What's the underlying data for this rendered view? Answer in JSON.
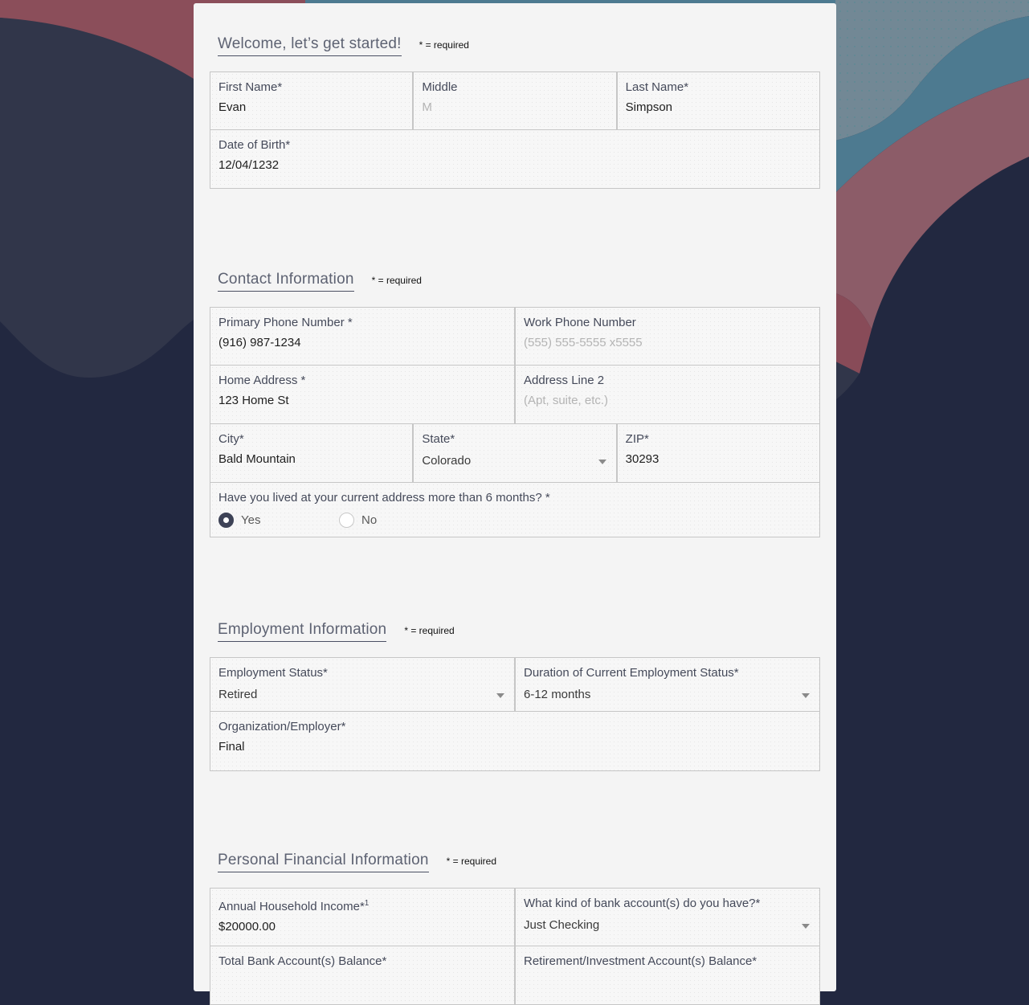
{
  "colors": {
    "background_navy": "#222840",
    "background_slate": "#31364a",
    "background_rose": "#8b4e5a",
    "background_mauve": "#8c5c68",
    "background_teal": "#4d7a90",
    "background_gray_blue": "#728895",
    "card": "#f4f4f4",
    "radio_selected": "#3d4256"
  },
  "sections": {
    "welcome": {
      "title": "Welcome, let’s get started!",
      "required_note": "* = required",
      "first_name": {
        "label": "First Name*",
        "value": "Evan"
      },
      "middle": {
        "label": "Middle",
        "placeholder": "M"
      },
      "last_name": {
        "label": "Last Name*",
        "value": "Simpson"
      },
      "dob": {
        "label": "Date of Birth*",
        "value": "12/04/1232"
      }
    },
    "contact": {
      "title": "Contact Information",
      "required_note": "* = required",
      "primary_phone": {
        "label": "Primary Phone Number *",
        "value": "(916) 987-1234"
      },
      "work_phone": {
        "label": "Work Phone Number",
        "placeholder": "(555) 555-5555 x5555"
      },
      "home_address": {
        "label": "Home Address *",
        "value": "123 Home St"
      },
      "address2": {
        "label": "Address Line 2",
        "placeholder": "(Apt, suite, etc.)"
      },
      "city": {
        "label": "City*",
        "value": "Bald Mountain"
      },
      "state": {
        "label": "State*",
        "value": "Colorado"
      },
      "zip": {
        "label": "ZIP*",
        "value": "30293"
      },
      "lived_question": {
        "label": "Have you lived at your current address more than 6 months? *",
        "options": [
          {
            "label": "Yes",
            "selected": true
          },
          {
            "label": "No",
            "selected": false
          }
        ]
      }
    },
    "employment": {
      "title": "Employment Information",
      "required_note": "* = required",
      "status": {
        "label": "Employment Status*",
        "value": "Retired"
      },
      "duration": {
        "label": "Duration of Current Employment Status*",
        "value": "6-12 months"
      },
      "employer": {
        "label": "Organization/Employer*",
        "value": "Final"
      }
    },
    "financial": {
      "title": "Personal Financial Information",
      "required_note": "* = required",
      "income": {
        "label": "Annual Household Income*",
        "footnote": "1",
        "value": "$20000.00"
      },
      "bank_kind": {
        "label": "What kind of bank account(s) do you have?*",
        "value": "Just Checking"
      },
      "bank_balance": {
        "label": "Total Bank Account(s) Balance*"
      },
      "retirement_balance": {
        "label": "Retirement/Investment Account(s) Balance*"
      }
    }
  }
}
